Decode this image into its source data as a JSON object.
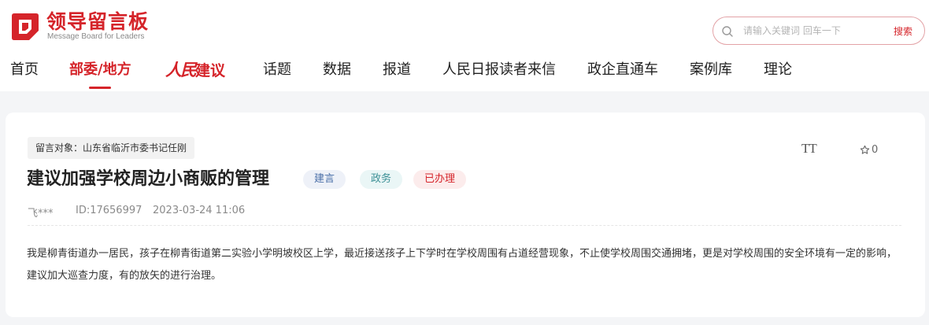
{
  "site": {
    "logo_title": "领导留言板",
    "logo_subtitle": "Message Board for Leaders"
  },
  "search": {
    "placeholder": "请输入关键词 回车一下",
    "button_label": "搜索"
  },
  "nav": {
    "items": [
      "首页",
      "部委/地方",
      "人民建议",
      "话题",
      "数据",
      "报道",
      "人民日报读者来信",
      "政企直通车",
      "案例库",
      "理论"
    ],
    "active_index": 1,
    "brand_script": "人民",
    "brand_rest": "建议"
  },
  "message": {
    "target": "留言对象：山东省临沂市委书记任刚",
    "title": "建议加强学校周边小商贩的管理",
    "badges": [
      "建言",
      "政务",
      "已办理"
    ],
    "author": "飞***",
    "id": "ID:17656997",
    "time": "2023-03-24 11:06",
    "content": "我是柳青街道办一居民，孩子在柳青街道第二实验小学明坡校区上学，最近接送孩子上下学时在学校周围有占道经营现象，不止使学校周围交通拥堵，更是对学校周围的安全环境有一定的影响，建议加大巡查力度，有的放矢的进行治理。",
    "font_tool_label": "TT",
    "favorite_count": "0"
  },
  "colors": {
    "brand_red": "#d5242a",
    "page_bg": "#f4f5f7"
  },
  "icons": {
    "logo": "logo-icon",
    "search": "search-icon",
    "font_size": "font-size-icon",
    "favorite": "star-icon"
  }
}
